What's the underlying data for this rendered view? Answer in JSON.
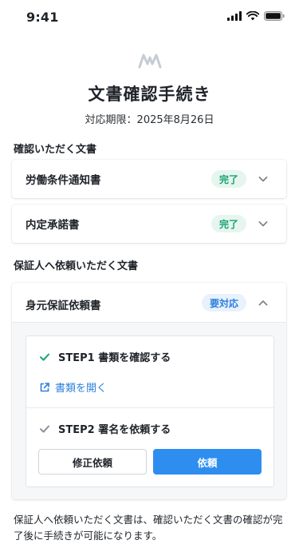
{
  "status_bar": {
    "time": "9:41"
  },
  "header": {
    "title": "文書確認手続き",
    "deadline": "対応期限：2025年8月26日"
  },
  "sections": {
    "confirm_title": "確認いただく文書",
    "guarantor_title": "保証人へ依頼いただく文書"
  },
  "documents": [
    {
      "name": "労働条件通知書",
      "status": "完了"
    },
    {
      "name": "内定承諾書",
      "status": "完了"
    }
  ],
  "guarantor_document": {
    "name": "身元保証依頼書",
    "status": "要対応",
    "step1_label": "STEP1 書類を確認する",
    "open_link": "書類を開く",
    "step2_label": "STEP2 署名を依頼する",
    "revise_button": "修正依頼",
    "request_button": "依頼"
  },
  "note": "保証人へ依頼いただく文書は、確認いただく文書の確認が完了後に手続きが可能になります。",
  "colors": {
    "done_badge_text": "#17a373",
    "done_badge_bg": "#e6f6ef",
    "todo_badge_text": "#2d7fdc",
    "todo_badge_bg": "#e8f2fd",
    "primary": "#2d8ef0"
  },
  "icons": {
    "signal": "cellular-signal-icon",
    "wifi": "wifi-icon",
    "battery": "battery-icon",
    "logo": "brand-logo-icon",
    "expand": "chevron-down-icon",
    "collapse": "chevron-up-icon",
    "step_done": "check-icon",
    "external": "external-link-icon"
  }
}
